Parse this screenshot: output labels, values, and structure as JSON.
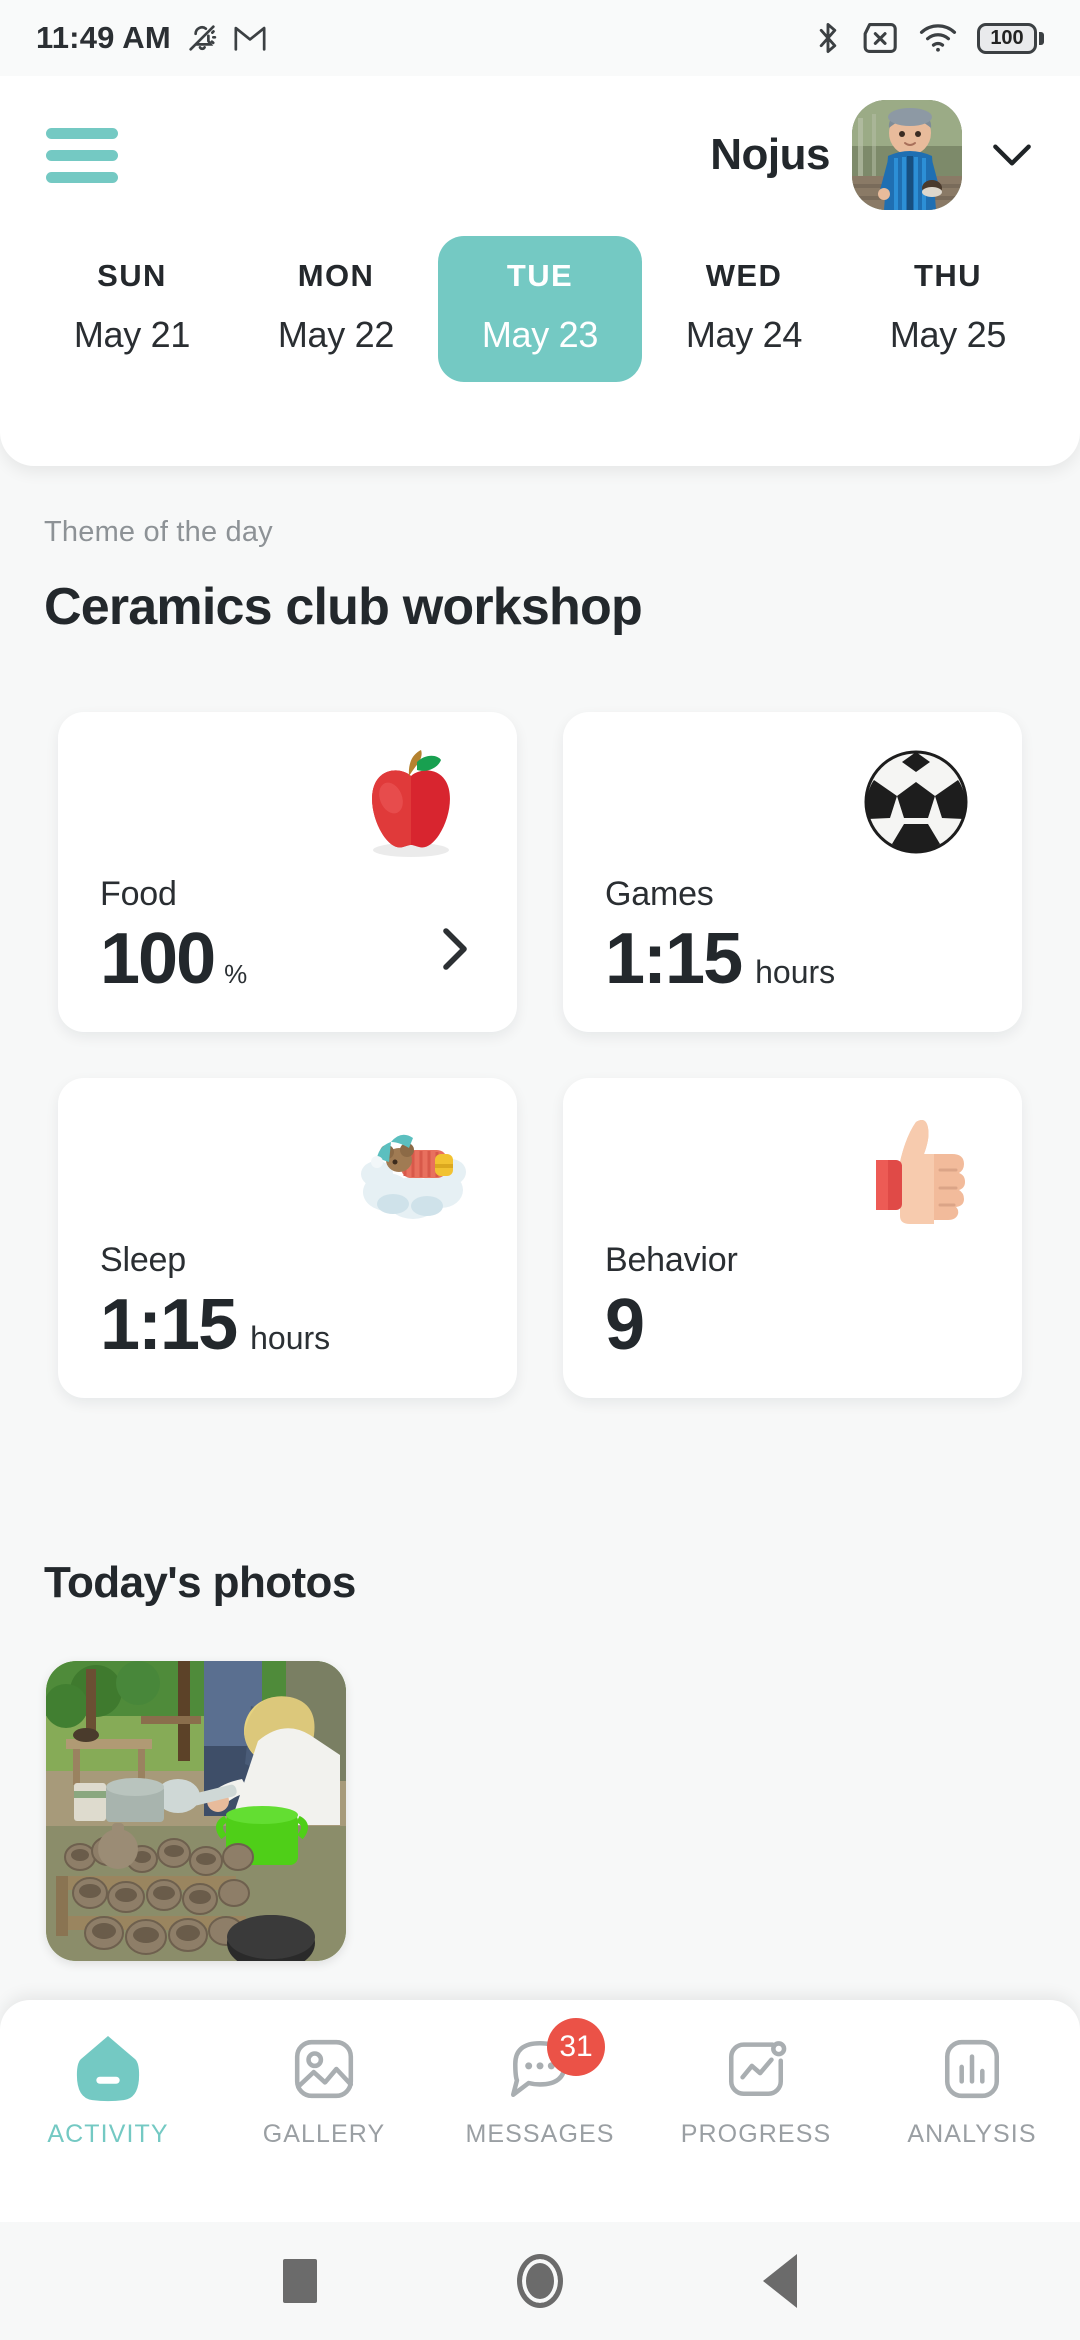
{
  "status_bar": {
    "time": "11:49 AM",
    "left_icons": [
      "notifications-silenced-icon",
      "gmail-icon"
    ],
    "right_icons": [
      "bluetooth-icon",
      "sim-missing-icon",
      "wifi-icon"
    ],
    "battery_level": "100"
  },
  "header": {
    "menu_icon": "hamburger-menu-icon",
    "child_name": "Nojus",
    "avatar_alt": "child-avatar",
    "dropdown_icon": "chevron-down-icon"
  },
  "days": [
    {
      "dow": "SUN",
      "date": "May 21",
      "selected": false
    },
    {
      "dow": "MON",
      "date": "May 22",
      "selected": false
    },
    {
      "dow": "TUE",
      "date": "May 23",
      "selected": true
    },
    {
      "dow": "WED",
      "date": "May 24",
      "selected": false
    },
    {
      "dow": "THU",
      "date": "May 25",
      "selected": false
    }
  ],
  "theme": {
    "label": "Theme of the day",
    "title": "Ceramics club workshop"
  },
  "stats": [
    {
      "label": "Food",
      "value": "100",
      "unit": "%",
      "emoji": "apple-emoji",
      "has_chevron": true
    },
    {
      "label": "Games",
      "value": "1:15",
      "unit": "hours",
      "emoji": "soccer-ball-emoji",
      "has_chevron": false
    },
    {
      "label": "Sleep",
      "value": "1:15",
      "unit": "hours",
      "emoji": "sleeping-bed-emoji",
      "has_chevron": false
    },
    {
      "label": "Behavior",
      "value": "9",
      "unit": "",
      "emoji": "thumbs-up-emoji",
      "has_chevron": false
    }
  ],
  "photos": {
    "title": "Today's photos",
    "thumbnail_alt": "ceramics-workshop-photo"
  },
  "bottom_nav": [
    {
      "label": "ACTIVITY",
      "icon": "activity-shield-icon",
      "active": true,
      "badge": ""
    },
    {
      "label": "GALLERY",
      "icon": "gallery-image-icon",
      "active": false,
      "badge": ""
    },
    {
      "label": "MESSAGES",
      "icon": "messages-chat-icon",
      "active": false,
      "badge": "31"
    },
    {
      "label": "PROGRESS",
      "icon": "progress-trend-icon",
      "active": false,
      "badge": ""
    },
    {
      "label": "ANALYSIS",
      "icon": "analysis-bars-icon",
      "active": false,
      "badge": ""
    }
  ],
  "android_nav": {
    "recents": "recents-square-icon",
    "home": "home-circle-icon",
    "back": "back-triangle-icon"
  },
  "colors": {
    "accent": "#74c9c3",
    "badge": "#eb5247",
    "text": "#23282c",
    "muted": "#9a9fa3",
    "background": "#f7f8f8",
    "card": "#ffffff"
  }
}
